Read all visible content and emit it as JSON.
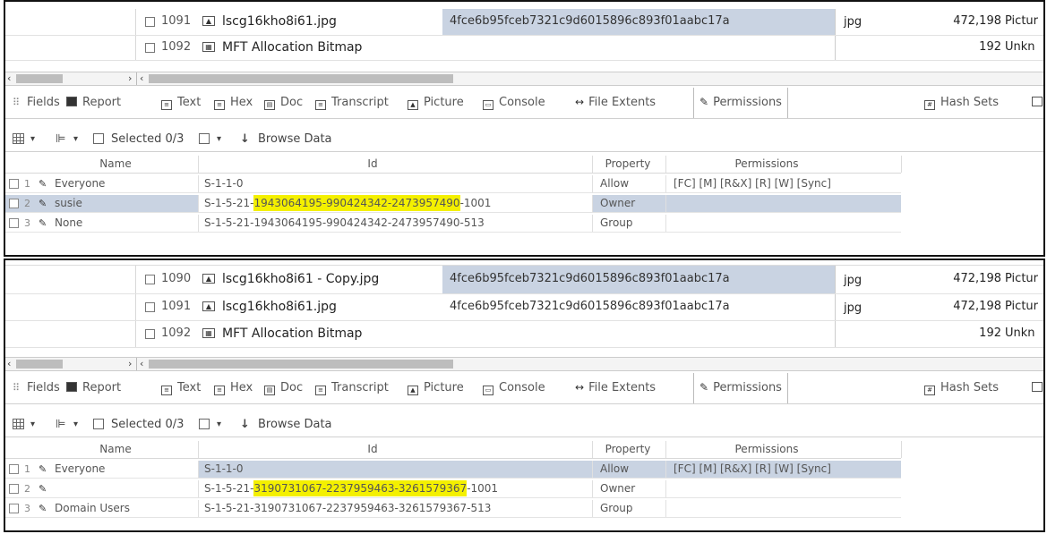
{
  "files_top": [
    {
      "num": "1091",
      "icon": "picture-icon",
      "name": "lscg16kho8i61.jpg",
      "hash": "4fce6b95fceb7321c9d6015896c893f01aabc17a",
      "ext": "jpg",
      "size": "472,198",
      "category": "Pictur",
      "hash_selected": true
    },
    {
      "num": "1092",
      "icon": "table-icon",
      "name": "MFT Allocation Bitmap",
      "hash": "",
      "ext": "",
      "size": "192",
      "category": "Unkn",
      "hash_selected": false
    }
  ],
  "files_bottom": [
    {
      "num": "1090",
      "icon": "picture-icon",
      "name": "lscg16kho8i61 - Copy.jpg",
      "hash": "4fce6b95fceb7321c9d6015896c893f01aabc17a",
      "ext": "jpg",
      "size": "472,198",
      "category": "Pictur",
      "hash_selected": true
    },
    {
      "num": "1091",
      "icon": "picture-icon",
      "name": "lscg16kho8i61.jpg",
      "hash": "4fce6b95fceb7321c9d6015896c893f01aabc17a",
      "ext": "jpg",
      "size": "472,198",
      "category": "Pictur",
      "hash_selected": false
    },
    {
      "num": "1092",
      "icon": "table-icon",
      "name": "MFT Allocation Bitmap",
      "hash": "",
      "ext": "",
      "size": "192",
      "category": "Unkn",
      "hash_selected": false
    }
  ],
  "tabs": [
    {
      "label": "Fields",
      "icon": "fields-icon"
    },
    {
      "label": "Report",
      "icon": "report-icon"
    },
    {
      "label": "Text",
      "icon": "text-icon"
    },
    {
      "label": "Hex",
      "icon": "hex-icon"
    },
    {
      "label": "Doc",
      "icon": "doc-icon"
    },
    {
      "label": "Transcript",
      "icon": "transcript-icon"
    },
    {
      "label": "Picture",
      "icon": "picture-icon"
    },
    {
      "label": "Console",
      "icon": "console-icon"
    },
    {
      "label": "File Extents",
      "icon": "file-extents-icon"
    },
    {
      "label": "Permissions",
      "icon": "permissions-icon",
      "active": true
    },
    {
      "label": "Hash Sets",
      "icon": "hash-sets-icon"
    }
  ],
  "toolbar": {
    "selected_label": "Selected 0/3",
    "browse_label": "Browse Data"
  },
  "perm_headers": {
    "name": "Name",
    "id": "Id",
    "property": "Property",
    "permissions": "Permissions"
  },
  "perm_top": [
    {
      "n": "1",
      "name": "Everyone",
      "id_pre": "S-1-1-0",
      "id_hl": "",
      "id_post": "",
      "property": "Allow",
      "permissions": "[FC] [M] [R&X] [R] [W] [Sync]"
    },
    {
      "n": "2",
      "name": "susie",
      "id_pre": "S-1-5-21-",
      "id_hl": "1943064195-990424342-2473957490",
      "id_post": "-1001",
      "property": "Owner",
      "permissions": ""
    },
    {
      "n": "3",
      "name": "None",
      "id_pre": "S-1-5-21-1943064195-990424342-2473957490-513",
      "id_hl": "",
      "id_post": "",
      "property": "Group",
      "permissions": ""
    }
  ],
  "perm_bottom": [
    {
      "n": "1",
      "name": "Everyone",
      "id_pre": "S-1-1-0",
      "id_hl": "",
      "id_post": "",
      "property": "Allow",
      "permissions": "[FC] [M] [R&X] [R] [W] [Sync]"
    },
    {
      "n": "2",
      "name": "",
      "id_pre": "S-1-5-21-",
      "id_hl": "3190731067-2237959463-3261579367",
      "id_post": "-1001",
      "property": "Owner",
      "permissions": ""
    },
    {
      "n": "3",
      "name": "Domain Users",
      "id_pre": "S-1-5-21-3190731067-2237959463-3261579367-513",
      "id_hl": "",
      "id_post": "",
      "property": "Group",
      "permissions": ""
    }
  ],
  "colors": {
    "highlight": "#f4f000",
    "selection": "#c9d3e2"
  }
}
